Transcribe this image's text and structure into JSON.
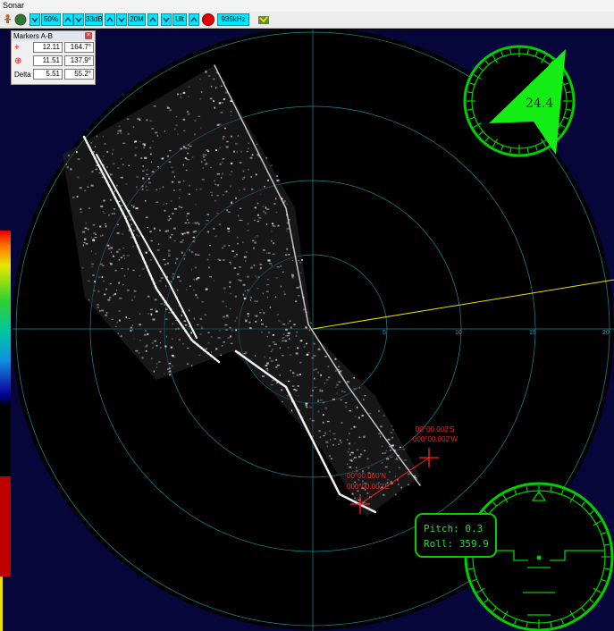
{
  "window": {
    "title": "Sonar"
  },
  "toolbar": {
    "gain_label": "50%",
    "db_label": "33dB",
    "range_label": "20M",
    "mode_label": "Ult",
    "freq_label": "935kHz"
  },
  "markers_panel": {
    "title": "Markers A-B",
    "rows": [
      {
        "label": "+",
        "v1": "12.11",
        "v2": "164.7°"
      },
      {
        "label": "⊕",
        "v1": "11.51",
        "v2": "137.9°"
      },
      {
        "label": "Delta",
        "v1": "5.51",
        "v2": "55.2°"
      }
    ]
  },
  "scale_labels": [
    "5",
    "10",
    "15",
    "20"
  ],
  "compass": {
    "heading": "24.4"
  },
  "attitude": {
    "pitch": "Pitch: 0.3",
    "roll": "Roll: 359.9"
  },
  "marker_a": {
    "lat": "00°00.002'S",
    "lon": "000°00.002'W"
  },
  "marker_b": {
    "lat": "00°00.000'N",
    "lon": "000°00.002'E"
  },
  "colors": {
    "ring": "#1fa5b5",
    "accent": "#00e8ff",
    "marker": "#ff2020",
    "gauge": "#00d000"
  }
}
